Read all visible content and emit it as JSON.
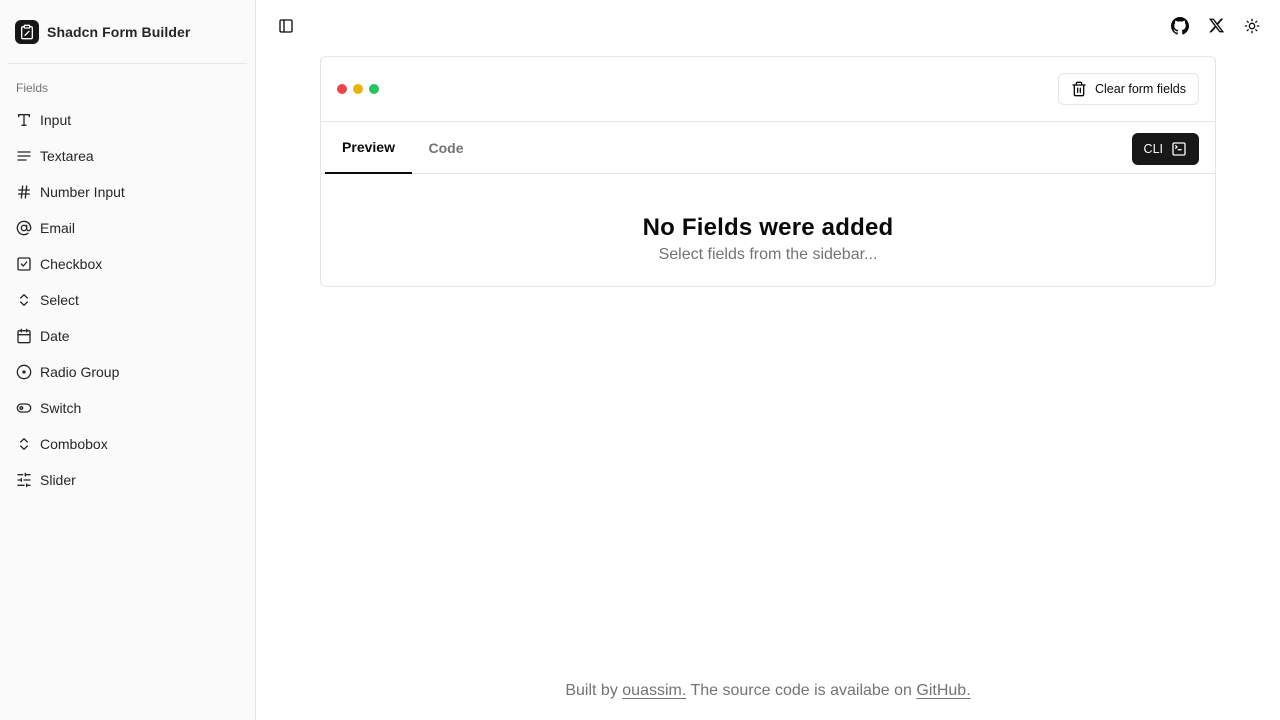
{
  "app": {
    "title": "Shadcn Form Builder"
  },
  "sidebar": {
    "group_label": "Fields",
    "items": [
      {
        "label": "Input",
        "icon": "type-icon"
      },
      {
        "label": "Textarea",
        "icon": "text-lines-icon"
      },
      {
        "label": "Number Input",
        "icon": "hash-icon"
      },
      {
        "label": "Email",
        "icon": "at-sign-icon"
      },
      {
        "label": "Checkbox",
        "icon": "checkbox-icon"
      },
      {
        "label": "Select",
        "icon": "chevrons-up-down-icon"
      },
      {
        "label": "Date",
        "icon": "calendar-icon"
      },
      {
        "label": "Radio Group",
        "icon": "radio-circle-icon"
      },
      {
        "label": "Switch",
        "icon": "toggle-icon"
      },
      {
        "label": "Combobox",
        "icon": "chevrons-up-down-icon"
      },
      {
        "label": "Slider",
        "icon": "sliders-icon"
      }
    ]
  },
  "card": {
    "clear_label": "Clear form fields",
    "tabs": {
      "preview": "Preview",
      "code": "Code"
    },
    "cli_label": "CLI",
    "empty_title": "No Fields were added",
    "empty_subtitle": "Select fields from the sidebar..."
  },
  "footer": {
    "prefix": "Built by ",
    "author": "ouassim.",
    "middle": " The source code is availabe on ",
    "github": "GitHub."
  },
  "colors": {
    "dot_red": "#ef4444",
    "dot_yellow": "#eab308",
    "dot_green": "#22c55e",
    "primary": "#171717",
    "muted": "#737373"
  }
}
